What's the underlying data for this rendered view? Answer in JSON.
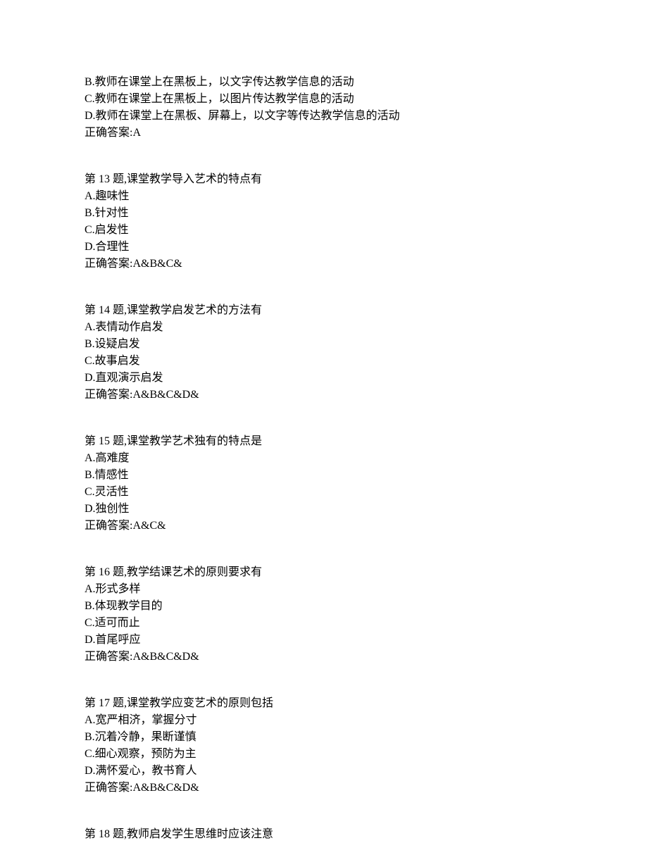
{
  "intro_block": {
    "lines": [
      "B.教师在课堂上在黑板上，以文字传达教学信息的活动",
      "C.教师在课堂上在黑板上，以图片传达教学信息的活动",
      "D.教师在课堂上在黑板、屏幕上，以文字等传达教学信息的活动"
    ],
    "answer": "正确答案:A"
  },
  "questions": [
    {
      "title": "第 13 题,课堂教学导入艺术的特点有",
      "options": [
        "A.趣味性",
        "B.针对性",
        "C.启发性",
        "D.合理性"
      ],
      "answer": "正确答案:A&B&C&"
    },
    {
      "title": "第 14 题,课堂教学启发艺术的方法有",
      "options": [
        "A.表情动作启发",
        "B.设疑启发",
        "C.故事启发",
        "D.直观演示启发"
      ],
      "answer": "正确答案:A&B&C&D&"
    },
    {
      "title": "第 15 题,课堂教学艺术独有的特点是",
      "options": [
        "A.高难度",
        "B.情感性",
        "C.灵活性",
        "D.独创性"
      ],
      "answer": "正确答案:A&C&"
    },
    {
      "title": "第 16 题,教学结课艺术的原则要求有",
      "options": [
        "A.形式多样",
        "B.体现教学目的",
        "C.适可而止",
        "D.首尾呼应"
      ],
      "answer": "正确答案:A&B&C&D&"
    },
    {
      "title": "第 17 题,课堂教学应变艺术的原则包括",
      "options": [
        "A.宽严相济，掌握分寸",
        "B.沉着冷静，果断谨慎",
        "C.细心观察，预防为主",
        "D.满怀爱心，教书育人"
      ],
      "answer": "正确答案:A&B&C&D&"
    },
    {
      "title": "第 18 题,教师启发学生思维时应该注意",
      "options": [],
      "answer": ""
    }
  ]
}
